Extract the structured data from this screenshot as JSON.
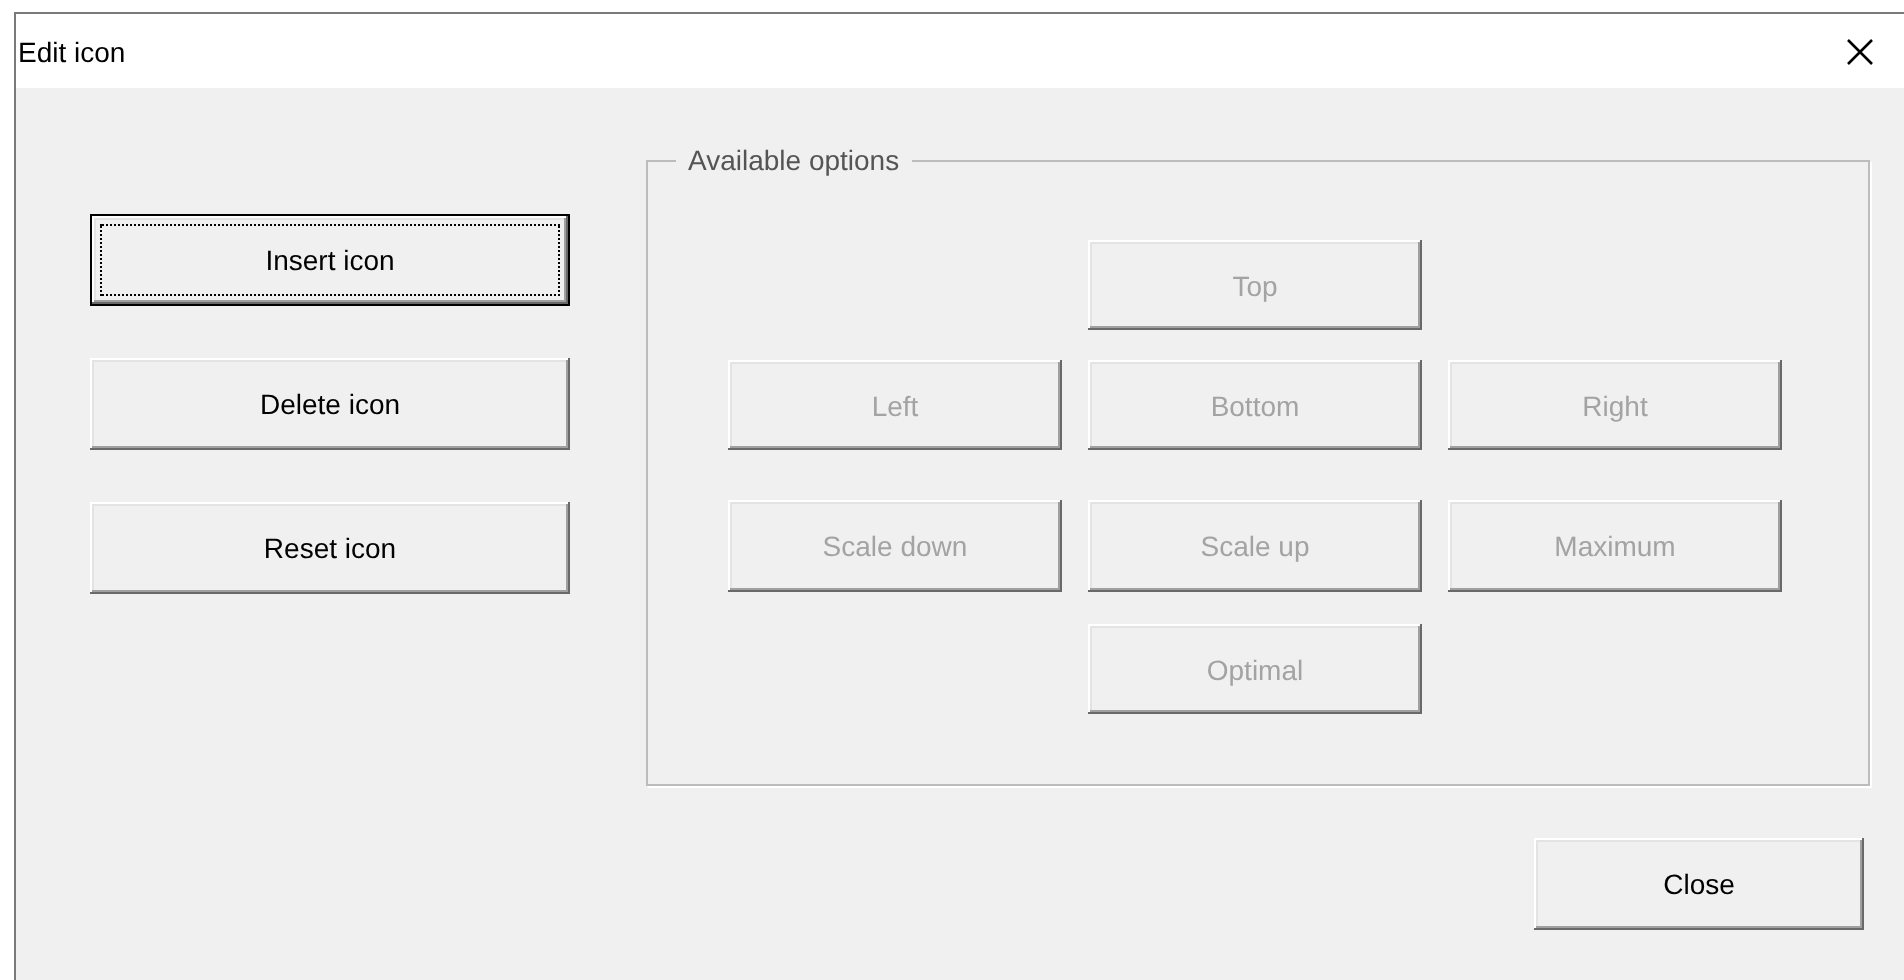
{
  "window": {
    "title": "Edit icon"
  },
  "actions": [
    {
      "label": "Insert icon",
      "focused": true,
      "disabled": false
    },
    {
      "label": "Delete icon",
      "focused": false,
      "disabled": false
    },
    {
      "label": "Reset icon",
      "focused": false,
      "disabled": false
    }
  ],
  "options_group": {
    "title": "Available options",
    "buttons": [
      {
        "label": "Top",
        "disabled": true
      },
      {
        "label": "Left",
        "disabled": true
      },
      {
        "label": "Bottom",
        "disabled": true
      },
      {
        "label": "Right",
        "disabled": true
      },
      {
        "label": "Scale down",
        "disabled": true
      },
      {
        "label": "Scale up",
        "disabled": true
      },
      {
        "label": "Maximum",
        "disabled": true
      },
      {
        "label": "Optimal",
        "disabled": true
      }
    ]
  },
  "footer_button": {
    "label": "Close",
    "focused": false,
    "disabled": false
  }
}
